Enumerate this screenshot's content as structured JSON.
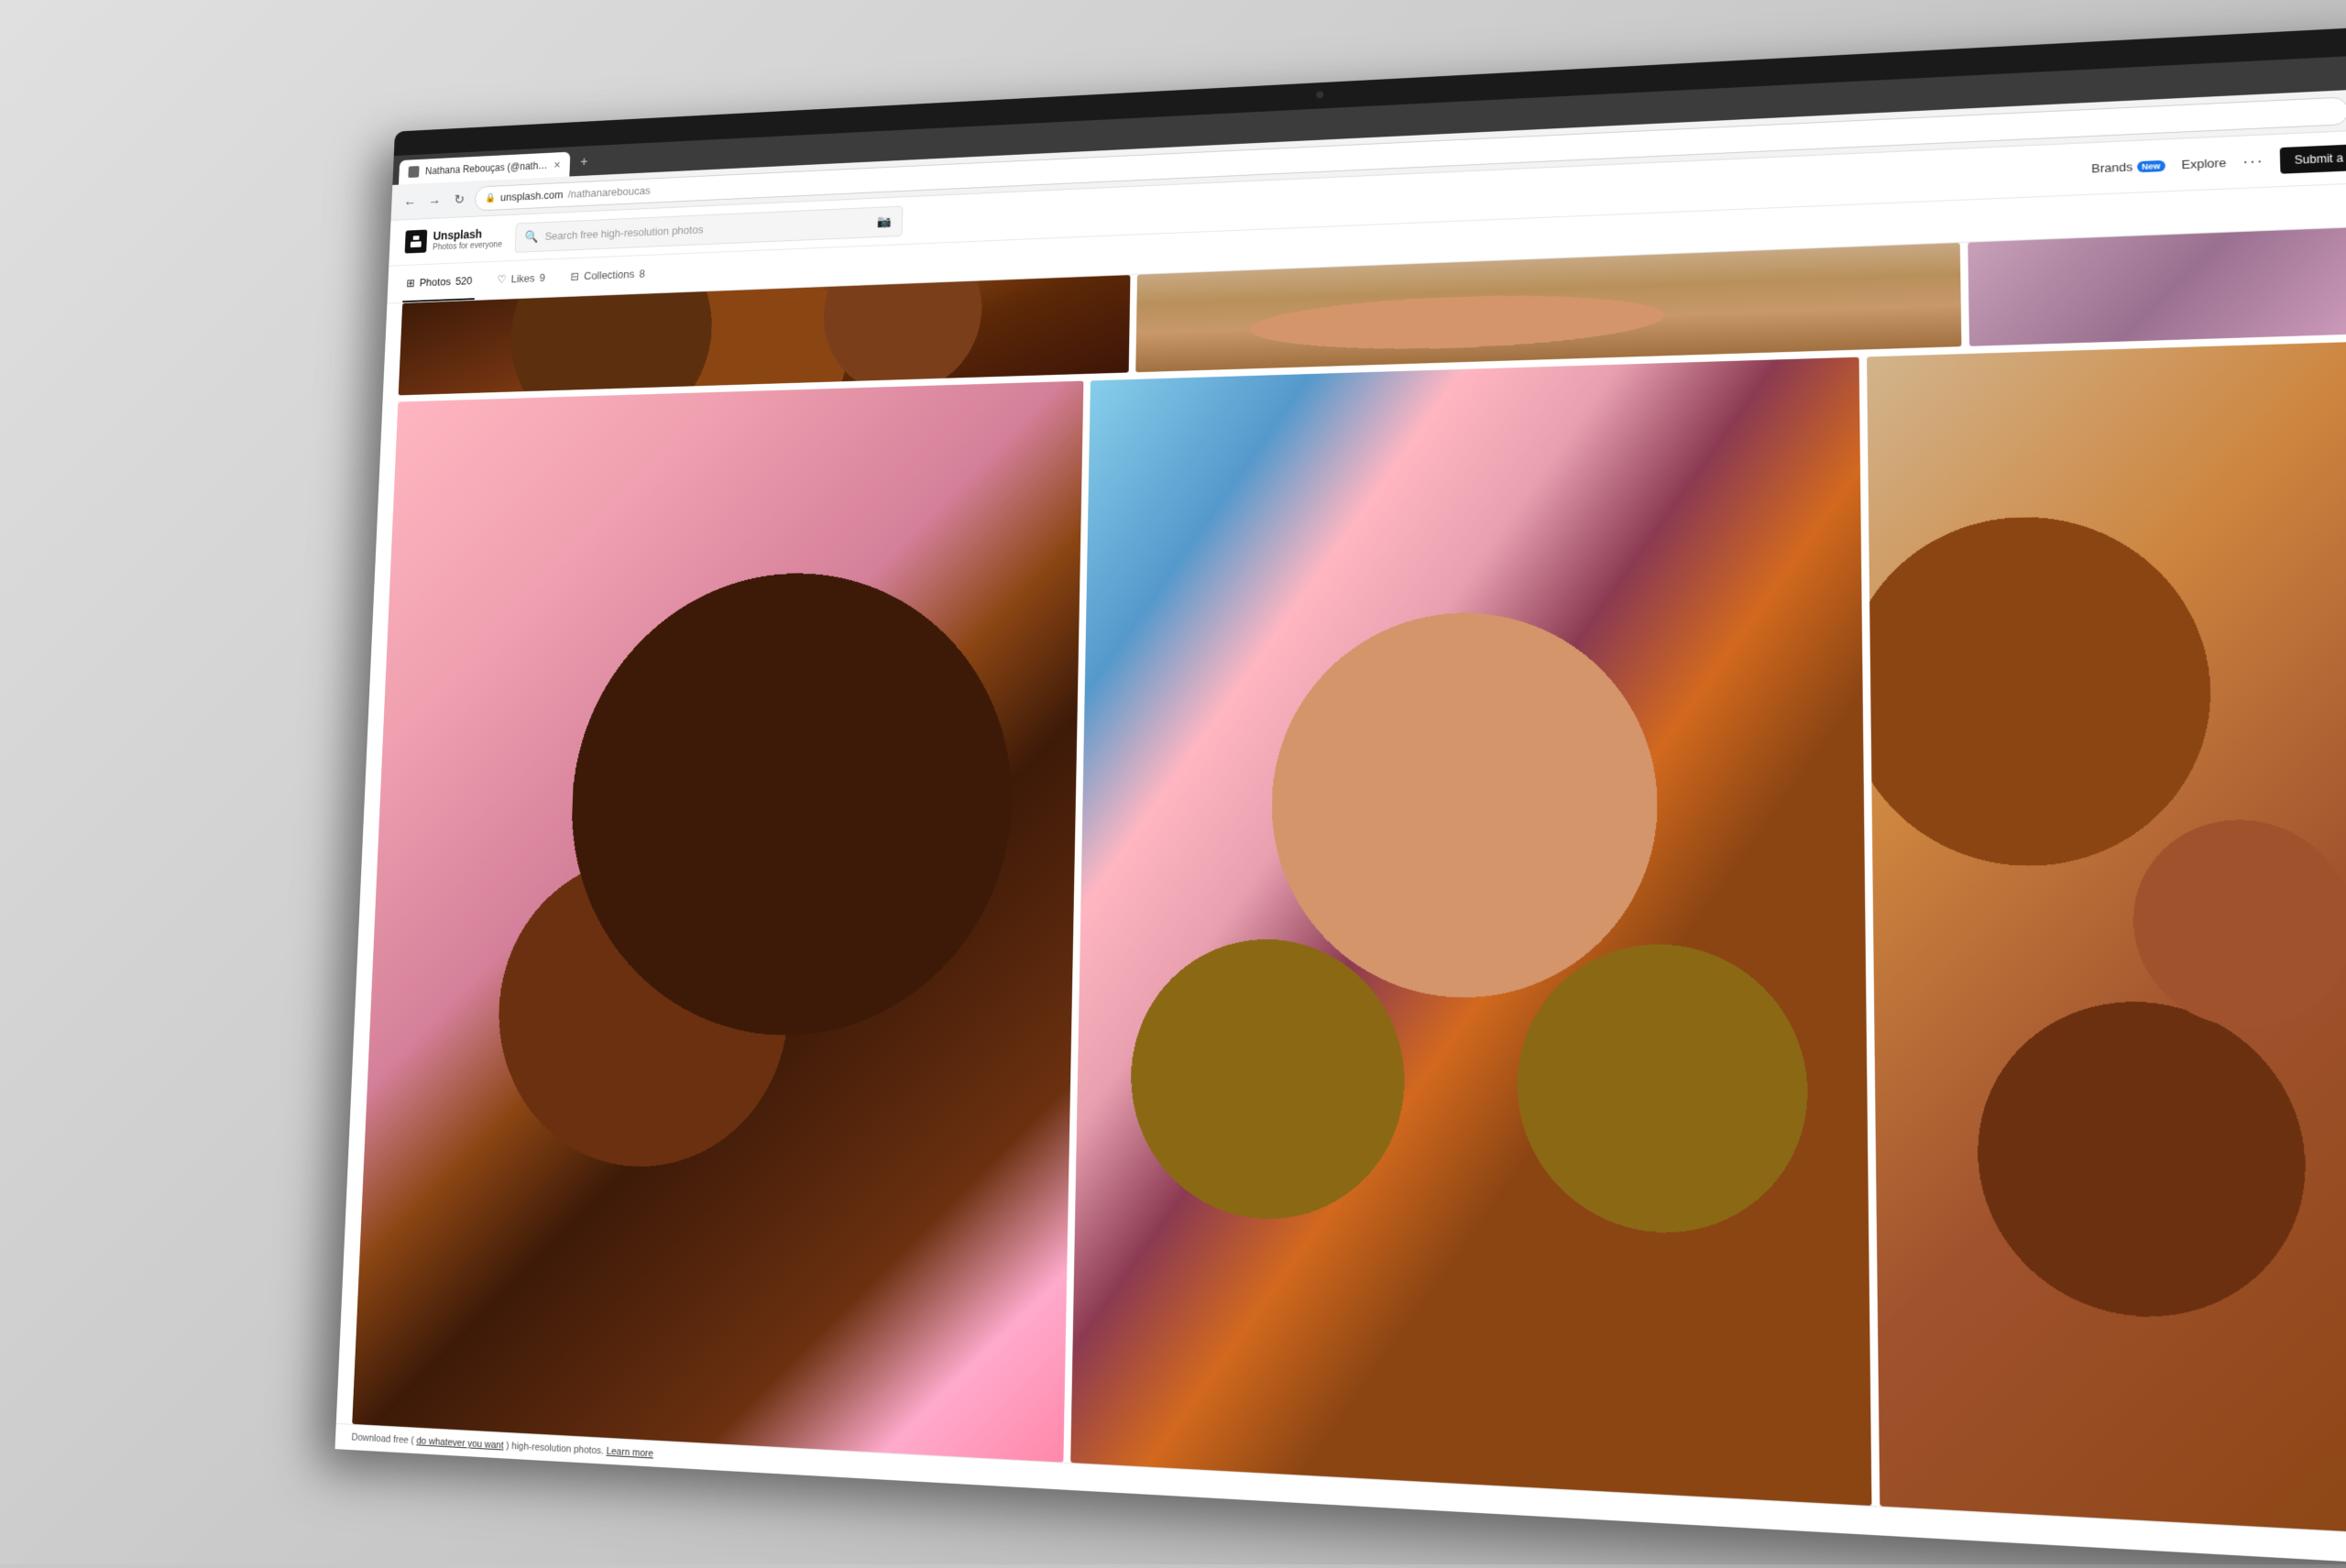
{
  "laptop": {
    "bezel_color": "#2a2a2a"
  },
  "browser": {
    "tab": {
      "title": "Nathana Rebouças (@natha...",
      "close_label": "×",
      "new_tab_label": "+"
    },
    "address": {
      "url_domain": "unsplash.com",
      "url_path": "/nathanareboucas",
      "lock_icon": "🔒"
    },
    "nav_buttons": {
      "back": "←",
      "forward": "→",
      "refresh": "↻"
    }
  },
  "unsplash": {
    "logo": {
      "name": "Unsplash",
      "tagline": "Photos for everyone",
      "icon": "⊞"
    },
    "search": {
      "placeholder": "Search free high-resolution photos"
    },
    "nav": {
      "brands_label": "Brands",
      "brands_badge": "New",
      "explore_label": "Explore",
      "more_label": "···",
      "submit_label": "Submit a pho"
    },
    "profile": {
      "tabs": [
        {
          "id": "photos",
          "icon": "⊞",
          "label": "Photos",
          "count": "520",
          "active": true
        },
        {
          "id": "likes",
          "icon": "♡",
          "label": "Likes",
          "count": "9",
          "active": false
        },
        {
          "id": "collections",
          "icon": "⊟",
          "label": "Collections",
          "count": "8",
          "active": false
        }
      ]
    },
    "footer": {
      "text1": "Download free (",
      "link_text": "do whatever you want",
      "text2": ") high-resolution photos. ",
      "learn_more": "Learn more"
    }
  },
  "photos": {
    "top_row": [
      {
        "id": "brownie",
        "style": "food-brownie-1",
        "width": "45%"
      },
      {
        "id": "pastry",
        "style": "food-pastry-top",
        "width": "45%"
      },
      {
        "id": "partial-right",
        "style": "food-nuts",
        "width": "10%"
      }
    ],
    "bottom_row": [
      {
        "id": "coffee-cake",
        "style": "food-coffee-cake",
        "width": "40%"
      },
      {
        "id": "chocolates",
        "style": "food-box-chocolates",
        "width": "40%"
      },
      {
        "id": "nuts",
        "style": "food-nuts",
        "width": "20%"
      }
    ]
  }
}
